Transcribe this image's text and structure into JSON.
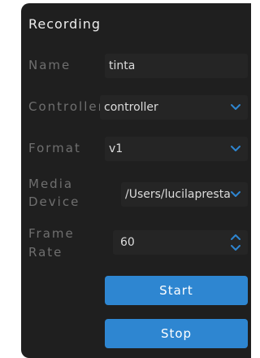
{
  "panel": {
    "title": "Recording"
  },
  "fields": {
    "name": {
      "label": "Name",
      "value": "tinta"
    },
    "controller": {
      "label": "Controller",
      "value": "controller",
      "icon": "chevron-down-icon"
    },
    "format": {
      "label": "Format",
      "value": "v1",
      "icon": "chevron-down-icon"
    },
    "media_device": {
      "label_line1": "Media",
      "label_line2": "Device",
      "value": "/Users/lucilapresta",
      "icon": "chevron-down-icon"
    },
    "frame_rate": {
      "label_line1": "Frame",
      "label_line2": "Rate",
      "value": "60",
      "icon": "stepper-icon"
    }
  },
  "buttons": {
    "start": "Start",
    "stop": "Stop"
  },
  "colors": {
    "accent": "#2e86d1",
    "panel_bg": "#1f1f1f",
    "field_bg": "#252525",
    "label": "#6f6f6f"
  }
}
